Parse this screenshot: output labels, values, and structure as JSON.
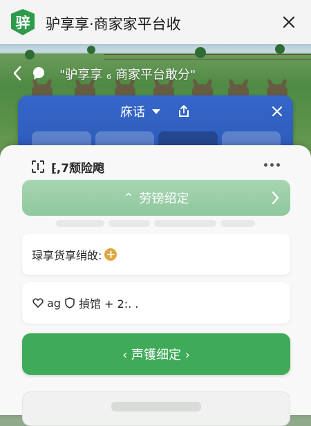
{
  "app_bar": {
    "logo_text": "骍",
    "title": "驴享享·商家家平台收",
    "close_icon": "close-icon"
  },
  "web_nav": {
    "back_icon": "chevron-left-icon",
    "chat_icon": "chat-bubble-icon",
    "title": "\"驴享享 ₆ 商家平台敢分\""
  },
  "sheet": {
    "title": "庥话",
    "dropdown_icon": "caret-down-icon",
    "share_icon": "share-icon",
    "close_icon": "close-icon"
  },
  "panel": {
    "head_label": "⁅,7颓险飑",
    "more_icon": "more-dots-icon",
    "bind_button_label": "劳镑绍定",
    "bind_button_arrow_prefix": "⌃",
    "field1_label": "琭享货享绡敀:",
    "field2_prefix": "ag",
    "field2_label": "揁馆 + 2:. .",
    "confirm_button_label": "‹ 声镬细定 ›"
  },
  "colors": {
    "brand_green": "#2e9a4b",
    "button_green": "#3fab59",
    "soft_green": "#9fd1ab",
    "sheet_blue": "#2f5fc2",
    "badge_orange": "#e0a740"
  }
}
